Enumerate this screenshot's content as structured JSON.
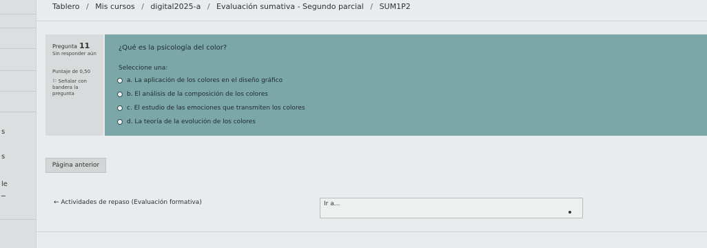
{
  "breadcrumb": {
    "items": [
      "Tablero",
      "Mis cursos",
      "digital2025-a",
      "Evaluación sumativa - Segundo parcial",
      "SUM1P2"
    ],
    "separator": "/"
  },
  "gutter": {
    "glyphs": [
      "s",
      "s",
      "le",
      "─"
    ]
  },
  "question_info": {
    "label": "Pregunta",
    "number": "11",
    "state": "Sin responder aún",
    "mark": "Puntaje de 0,50",
    "flag": "Señalar con bandera la pregunta"
  },
  "question": {
    "text": "¿Qué es la psicología del color?",
    "prompt": "Seleccione una:",
    "options": [
      "a. La aplicación de los colores en el diseño gráfico",
      "b. El análisis de la composición de los colores",
      "c. El estudio de las emociones que transmiten los colores",
      "d. La teoría de la evolución de los colores"
    ]
  },
  "navigation": {
    "prev_label": "Página anterior",
    "activity_link": "← Actividades de repaso (Evaluación formativa)",
    "goto_label": "Ir a..."
  },
  "colors": {
    "question_panel": "#7ca7a8",
    "info_box": "#d7dbdb",
    "background": "#e9ecec"
  }
}
